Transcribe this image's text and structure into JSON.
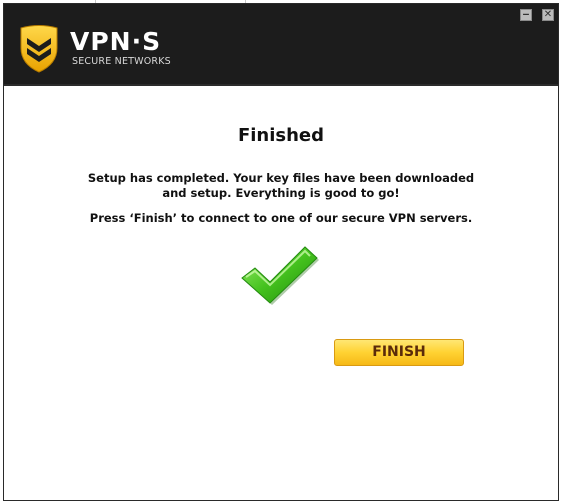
{
  "window": {
    "brand_name": "VPN·S",
    "brand_tagline": "SECURE NETWORKS",
    "minimize_glyph": "‒",
    "close_glyph": "✕"
  },
  "icons": {
    "logo": "shield-chevron-icon",
    "status": "checkmark-icon"
  },
  "content": {
    "title": "Finished",
    "message_line1": "Setup has completed. Your key files have been downloaded",
    "message_line2": "and setup. Everything is good to go!",
    "instruction": "Press ‘Finish’ to connect to one of our secure VPN servers.",
    "finish_label": "FINISH"
  },
  "colors": {
    "header_bg": "#1c1c1c",
    "accent_gold": "#f5b400",
    "check_green": "#3fb81c",
    "button_text": "#5a2a0a"
  }
}
